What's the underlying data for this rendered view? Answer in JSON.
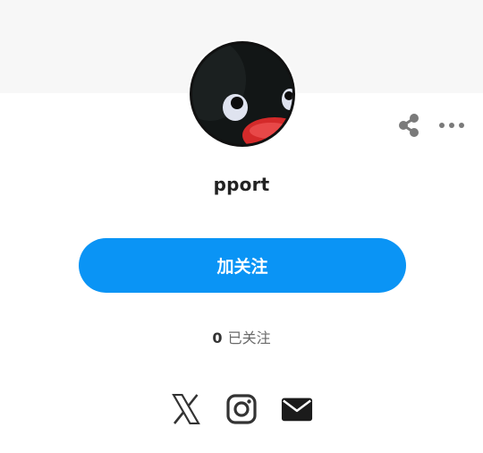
{
  "profile": {
    "username": "pport",
    "following_count": "0",
    "following_label": "已关注"
  },
  "actions": {
    "follow_label": "加关注"
  },
  "icons": {
    "share": "share-icon",
    "more": "more-horizontal-icon",
    "x": "x-twitter-icon",
    "instagram": "instagram-icon",
    "email": "email-icon"
  },
  "colors": {
    "accent": "#0a94f5",
    "cover": "#f7f7f7",
    "icon": "#333333"
  }
}
